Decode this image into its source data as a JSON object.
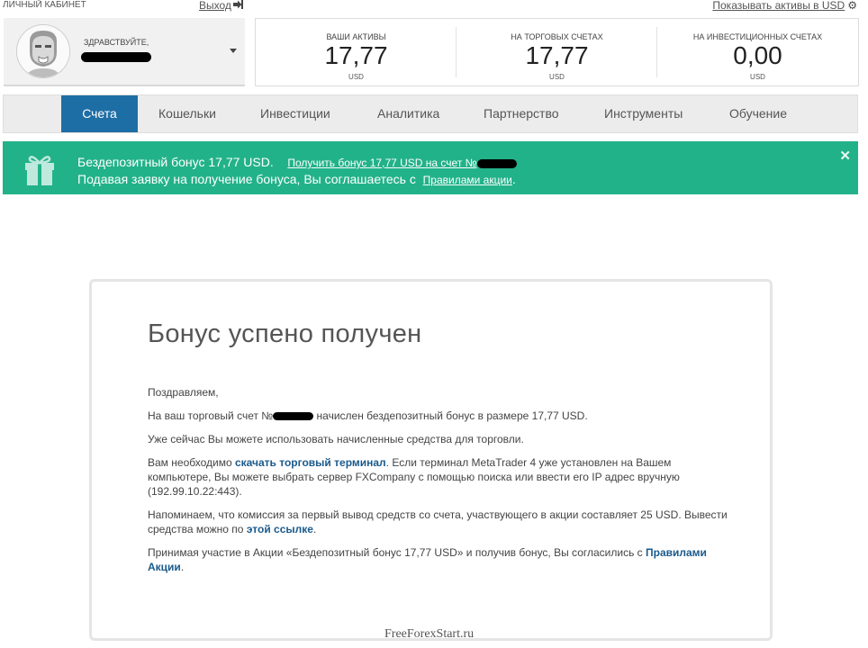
{
  "topbar": {
    "cabinet_label": "ЛИЧНЫЙ КАБИНЕТ",
    "logout_label": "Выход",
    "logout_icon": "logout-icon",
    "show_assets_label": "Показывать активы в USD",
    "settings_icon": "gear-icon"
  },
  "user": {
    "greeting": "ЗДРАВСТВУЙТЕ,",
    "avatar_icon": "avatar-icon",
    "dropdown_icon": "chevron-down-icon"
  },
  "assets": [
    {
      "label": "ВАШИ АКТИВЫ",
      "value": "17,77",
      "currency": "USD"
    },
    {
      "label": "НА ТОРГОВЫХ СЧЕТАХ",
      "value": "17,77",
      "currency": "USD"
    },
    {
      "label": "НА ИНВЕСТИЦИОННЫХ СЧЕТАХ",
      "value": "0,00",
      "currency": "USD"
    }
  ],
  "nav": {
    "items": [
      {
        "label": "Счета"
      },
      {
        "label": "Кошельки"
      },
      {
        "label": "Инвестиции"
      },
      {
        "label": "Аналитика"
      },
      {
        "label": "Партнерство"
      },
      {
        "label": "Инструменты"
      },
      {
        "label": "Обучение"
      }
    ],
    "active": "Счета"
  },
  "bonus_bar": {
    "gift_icon": "gift-icon",
    "text1": "Бездепозитный бонус 17,77 USD.",
    "link1": "Получить бонус 17,77 USD на счет №",
    "text2": "Подавая заявку на получение бонуса, Вы соглашаетесь с",
    "link2": "Правилами акции",
    "text2_end": ".",
    "close_icon": "close-icon",
    "background_color": "#22b289"
  },
  "card": {
    "title": "Бонус успено получен",
    "p1": "Поздравляем,",
    "p2_a": "На ваш торговый счет №",
    "p2_b": "начислен бездепозитный бонус в размере 17,77 USD.",
    "p3": "Уже сейчас Вы можете использовать начисленные средства для торговли.",
    "p4_a": "Вам необходимо",
    "p4_link": "скачать торговый терминал",
    "p4_b": ". Если терминал MetaTrader 4 уже установлен на Вашем компьютере, Вы можете выбрать сервер FXCompany с помощью поиска или ввести его IP адрес вручную (192.99.10.22:443).",
    "p5_a": "Напоминаем, что комиссия за первый вывод средств со счета, участвующего в акции составляет 25 USD. Вывести средства можно по",
    "p5_link": "этой ссылке",
    "p5_b": ".",
    "p6_a": "Принимая участие в Акции «Бездепозитный бонус 17,77 USD» и получив бонус, Вы согласились с",
    "p6_link": "Правилами Акции",
    "p6_b": "."
  },
  "watermark": "FreeForexStart.ru",
  "colors": {
    "nav_active": "#1e6ea6",
    "link": "#1a5a8c"
  }
}
